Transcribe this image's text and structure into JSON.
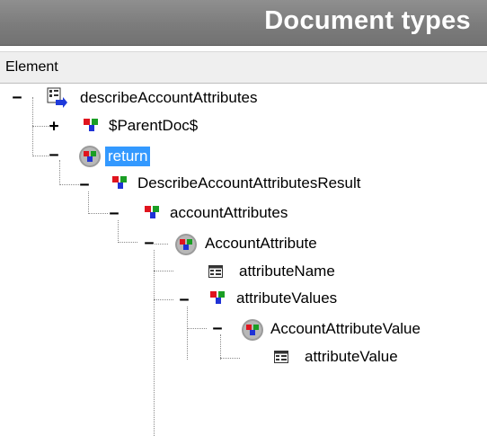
{
  "panel": {
    "title": "Document types"
  },
  "columns": {
    "element": "Element"
  },
  "tree": {
    "root": {
      "label": "describeAccountAttributes",
      "icon": "document-root-icon",
      "expanded": true
    },
    "parent_doc": {
      "label": "$ParentDoc$",
      "icon": "node-icon",
      "expanded": false
    },
    "return": {
      "label": "return",
      "icon": "complex-type-icon",
      "expanded": true,
      "selected": true
    },
    "result": {
      "label": "DescribeAccountAttributesResult",
      "icon": "node-icon",
      "expanded": true
    },
    "account_attributes": {
      "label": "accountAttributes",
      "icon": "node-icon",
      "expanded": true
    },
    "account_attribute": {
      "label": "AccountAttribute",
      "icon": "complex-type-icon",
      "expanded": true
    },
    "attribute_name": {
      "label": "attributeName",
      "icon": "field-icon"
    },
    "attribute_values": {
      "label": "attributeValues",
      "icon": "node-icon",
      "expanded": true
    },
    "account_attribute_value": {
      "label": "AccountAttributeValue",
      "icon": "complex-type-icon",
      "expanded": true
    },
    "attribute_value": {
      "label": "attributeValue",
      "icon": "field-icon"
    }
  },
  "colors": {
    "selection": "#3399ff",
    "title_bar": "#7c7c7c"
  }
}
